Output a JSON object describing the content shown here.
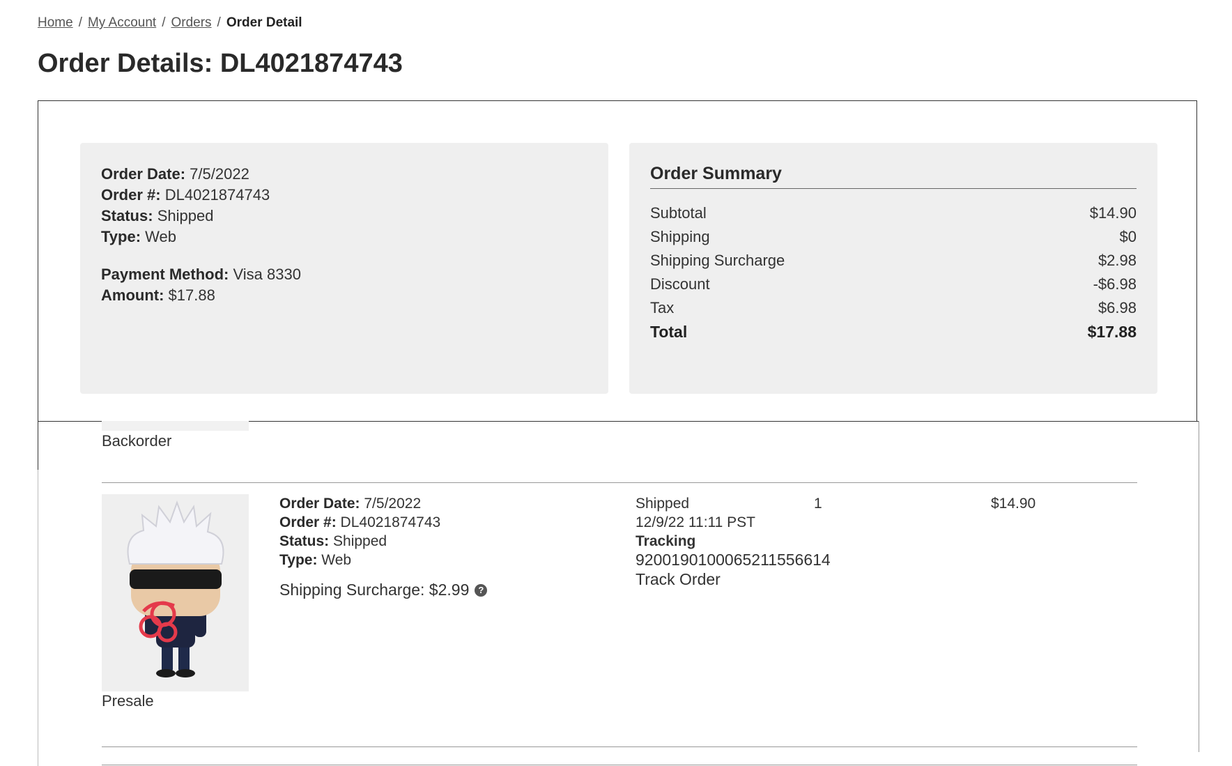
{
  "breadcrumb": {
    "home": "Home",
    "account": "My Account",
    "orders": "Orders",
    "current": "Order Detail",
    "separator": "/"
  },
  "page_title": "Order Details: DL4021874743",
  "order_info": {
    "order_date_label": "Order Date:",
    "order_date": "7/5/2022",
    "order_number_label": "Order #:",
    "order_number": "DL4021874743",
    "status_label": "Status:",
    "status": "Shipped",
    "type_label": "Type:",
    "type": "Web",
    "payment_method_label": "Payment Method:",
    "payment_method": "Visa 8330",
    "amount_label": "Amount:",
    "amount": "$17.88"
  },
  "summary": {
    "title": "Order Summary",
    "rows": [
      {
        "label": "Subtotal",
        "value": "$14.90"
      },
      {
        "label": "Shipping",
        "value": "$0"
      },
      {
        "label": "Shipping Surcharge",
        "value": "$2.98"
      },
      {
        "label": "Discount",
        "value": "-$6.98"
      },
      {
        "label": "Tax",
        "value": "$6.98"
      }
    ],
    "total_label": "Total",
    "total_value": "$17.88"
  },
  "items": [
    {
      "tag": "Backorder"
    },
    {
      "tag": "Presale",
      "icon": "funko-figure-image",
      "order_date_label": "Order Date:",
      "order_date": "7/5/2022",
      "order_number_label": "Order #:",
      "order_number": "DL4021874743",
      "status_label": "Status:",
      "status": "Shipped",
      "type_label": "Type:",
      "type": "Web",
      "surcharge": "Shipping Surcharge: $2.99",
      "shipment_status": "Shipped",
      "shipment_date": "12/9/22 11:11 PST",
      "tracking_label": "Tracking",
      "tracking_number": "9200190100065211556614",
      "track_link": "Track Order",
      "quantity": "1",
      "price": "$14.90"
    }
  ],
  "colors": {
    "panel_bg": "#efefef",
    "border": "#333333",
    "text": "#333333"
  }
}
